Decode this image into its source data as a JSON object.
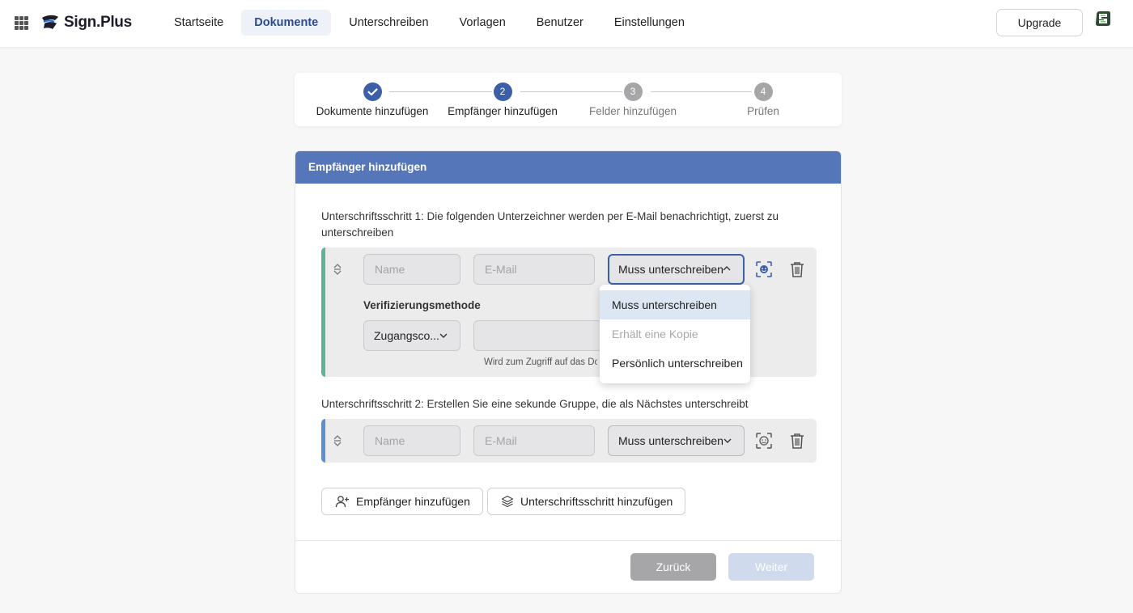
{
  "app": {
    "brand": "Sign.Plus",
    "upgrade_label": "Upgrade"
  },
  "nav": {
    "items": [
      "Startseite",
      "Dokumente",
      "Unterschreiben",
      "Vorlagen",
      "Benutzer",
      "Einstellungen"
    ],
    "active": "Dokumente"
  },
  "stepper": {
    "steps": [
      {
        "number": "",
        "label": "Dokumente hinzufügen",
        "state": "done"
      },
      {
        "number": "2",
        "label": "Empfänger hinzufügen",
        "state": "active"
      },
      {
        "number": "3",
        "label": "Felder hinzufügen",
        "state": "pending"
      },
      {
        "number": "4",
        "label": "Prüfen",
        "state": "pending"
      }
    ]
  },
  "card": {
    "title": "Empfänger hinzufügen",
    "step1_text": "Unterschriftsschritt 1: Die folgenden Unterzeichner werden per E-Mail benachrichtigt, zuerst zu unterschreiben",
    "step2_text": "Unterschriftsschritt 2: Erstellen Sie eine sekunde Gruppe, die als Nächstes unterschreibt",
    "group1": {
      "name_placeholder": "Name",
      "email_placeholder": "E-Mail",
      "role_value": "Muss unterschreiben",
      "verification_label": "Verifizierungsmethode",
      "verification_value": "Zugangsco...",
      "access_code_value": "",
      "hint": "Wird zum Zugriff auf das Dokument"
    },
    "group2": {
      "name_placeholder": "Name",
      "email_placeholder": "E-Mail",
      "role_value": "Muss unterschreiben"
    },
    "role_dropdown": [
      {
        "label": "Muss unterschreiben",
        "state": "selected"
      },
      {
        "label": "Erhält eine Kopie",
        "state": "disabled"
      },
      {
        "label": "Persönlich unterschreiben",
        "state": "normal"
      }
    ],
    "add_recipient_label": "Empfänger hinzufügen",
    "add_step_label": "Unterschriftsschritt hinzufügen",
    "back_label": "Zurück",
    "next_label": "Weiter"
  },
  "colors": {
    "accent": "#5576b9",
    "step_done": "#3c5fa8",
    "step_pending": "#a6a6a9",
    "group1_bar": "#5cb59a",
    "group2_bar": "#5b8fd1"
  }
}
